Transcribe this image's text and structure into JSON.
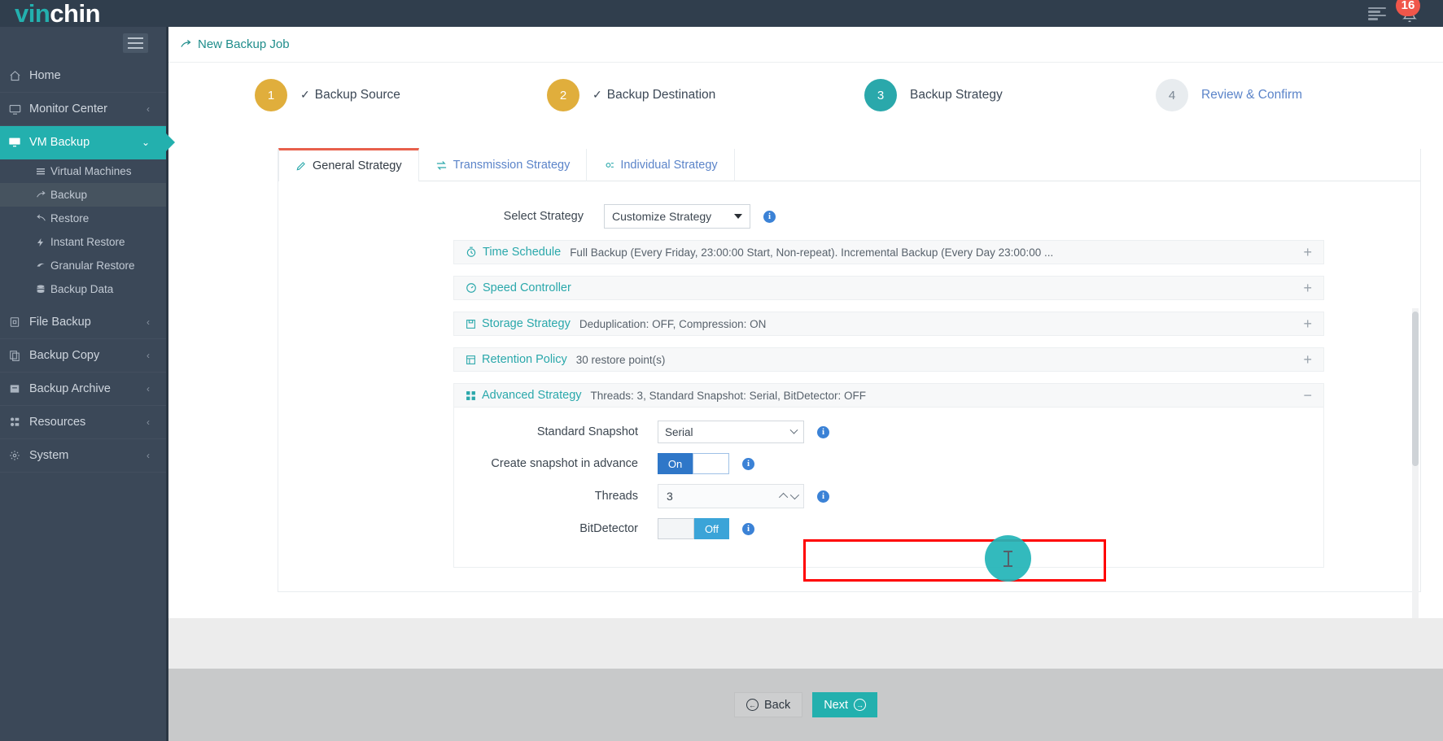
{
  "topbar": {
    "logo_vin": "vin",
    "logo_chin": "chin",
    "notification_count": "16",
    "menu_icon": "list-icon",
    "bell_icon": "bell-icon"
  },
  "sidebar": {
    "toggle_icon": "hamburger-icon",
    "items": [
      {
        "label": "Home",
        "icon": "home-icon",
        "arrow": "",
        "state": "normal"
      },
      {
        "label": "Monitor Center",
        "icon": "monitor-icon",
        "arrow": "‹",
        "state": "normal"
      },
      {
        "label": "VM Backup",
        "icon": "desktop-icon",
        "arrow": "⌄",
        "state": "active"
      }
    ],
    "sub_items": [
      {
        "label": "Virtual Machines",
        "icon": "list-lines-icon",
        "selected": false
      },
      {
        "label": "Backup",
        "icon": "backup-arrow-icon",
        "selected": true
      },
      {
        "label": "Restore",
        "icon": "restore-arrow-icon",
        "selected": false
      },
      {
        "label": "Instant Restore",
        "icon": "bolt-icon",
        "selected": false
      },
      {
        "label": "Granular Restore",
        "icon": "granular-icon",
        "selected": false
      },
      {
        "label": "Backup Data",
        "icon": "database-icon",
        "selected": false
      }
    ],
    "items_bottom": [
      {
        "label": "File Backup",
        "icon": "file-icon",
        "arrow": "‹"
      },
      {
        "label": "Backup Copy",
        "icon": "copy-icon",
        "arrow": "‹"
      },
      {
        "label": "Backup Archive",
        "icon": "archive-icon",
        "arrow": "‹"
      },
      {
        "label": "Resources",
        "icon": "resources-icon",
        "arrow": "‹"
      },
      {
        "label": "System",
        "icon": "system-icon",
        "arrow": "‹"
      }
    ]
  },
  "breadcrumb": {
    "icon": "backup-job-icon",
    "label": "New Backup Job"
  },
  "steps": [
    {
      "num": "1",
      "label": "Backup Source",
      "state": "done",
      "check": "✓"
    },
    {
      "num": "2",
      "label": "Backup Destination",
      "state": "done",
      "check": "✓"
    },
    {
      "num": "3",
      "label": "Backup Strategy",
      "state": "cur",
      "check": ""
    },
    {
      "num": "4",
      "label": "Review & Confirm",
      "state": "todo",
      "check": ""
    }
  ],
  "tabs": [
    {
      "label": "General Strategy",
      "icon": "pencil-icon",
      "active": true
    },
    {
      "label": "Transmission Strategy",
      "icon": "transfer-icon",
      "active": false
    },
    {
      "label": "Individual Strategy",
      "icon": "gear-icon",
      "active": false
    }
  ],
  "select_strategy": {
    "label": "Select Strategy",
    "value": "Customize Strategy",
    "options": [
      "Customize Strategy"
    ]
  },
  "accordions": [
    {
      "title": "Time Schedule",
      "icon": "clock-icon",
      "desc": "Full Backup (Every Friday, 23:00:00 Start, Non-repeat). Incremental Backup (Every Day 23:00:00 ...",
      "toggle": "+",
      "open": false
    },
    {
      "title": "Speed Controller",
      "icon": "speed-icon",
      "desc": "",
      "toggle": "+",
      "open": false
    },
    {
      "title": "Storage Strategy",
      "icon": "save-icon",
      "desc": "Deduplication: OFF, Compression: ON",
      "toggle": "+",
      "open": false
    },
    {
      "title": "Retention Policy",
      "icon": "retention-icon",
      "desc": "30 restore point(s)",
      "toggle": "+",
      "open": false
    },
    {
      "title": "Advanced Strategy",
      "icon": "grid-icon",
      "desc": "Threads: 3, Standard Snapshot: Serial, BitDetector: OFF",
      "toggle": "−",
      "open": true
    }
  ],
  "advanced": {
    "standard_snapshot": {
      "label": "Standard Snapshot",
      "value": "Serial",
      "options": [
        "Serial"
      ]
    },
    "create_snapshot_in_advance": {
      "label": "Create snapshot in advance",
      "value": "On"
    },
    "threads": {
      "label": "Threads",
      "value": "3"
    },
    "bitdetector": {
      "label": "BitDetector",
      "value": "Off"
    }
  },
  "footer": {
    "back_label": "Back",
    "next_label": "Next",
    "back_icon": "arrow-left-circle-icon",
    "next_icon": "arrow-right-circle-icon"
  },
  "colors": {
    "brand_teal": "#23b0ae",
    "sidebar_bg": "#3b4858",
    "topbar_bg": "#303e4d",
    "step_done": "#e0ae3c",
    "step_current": "#2aa8ab",
    "highlight_red": "#ff0000",
    "toggle_on_blue": "#2f77c8",
    "toggle_off_blue": "#3ba4d8",
    "badge_red": "#f0564a"
  }
}
